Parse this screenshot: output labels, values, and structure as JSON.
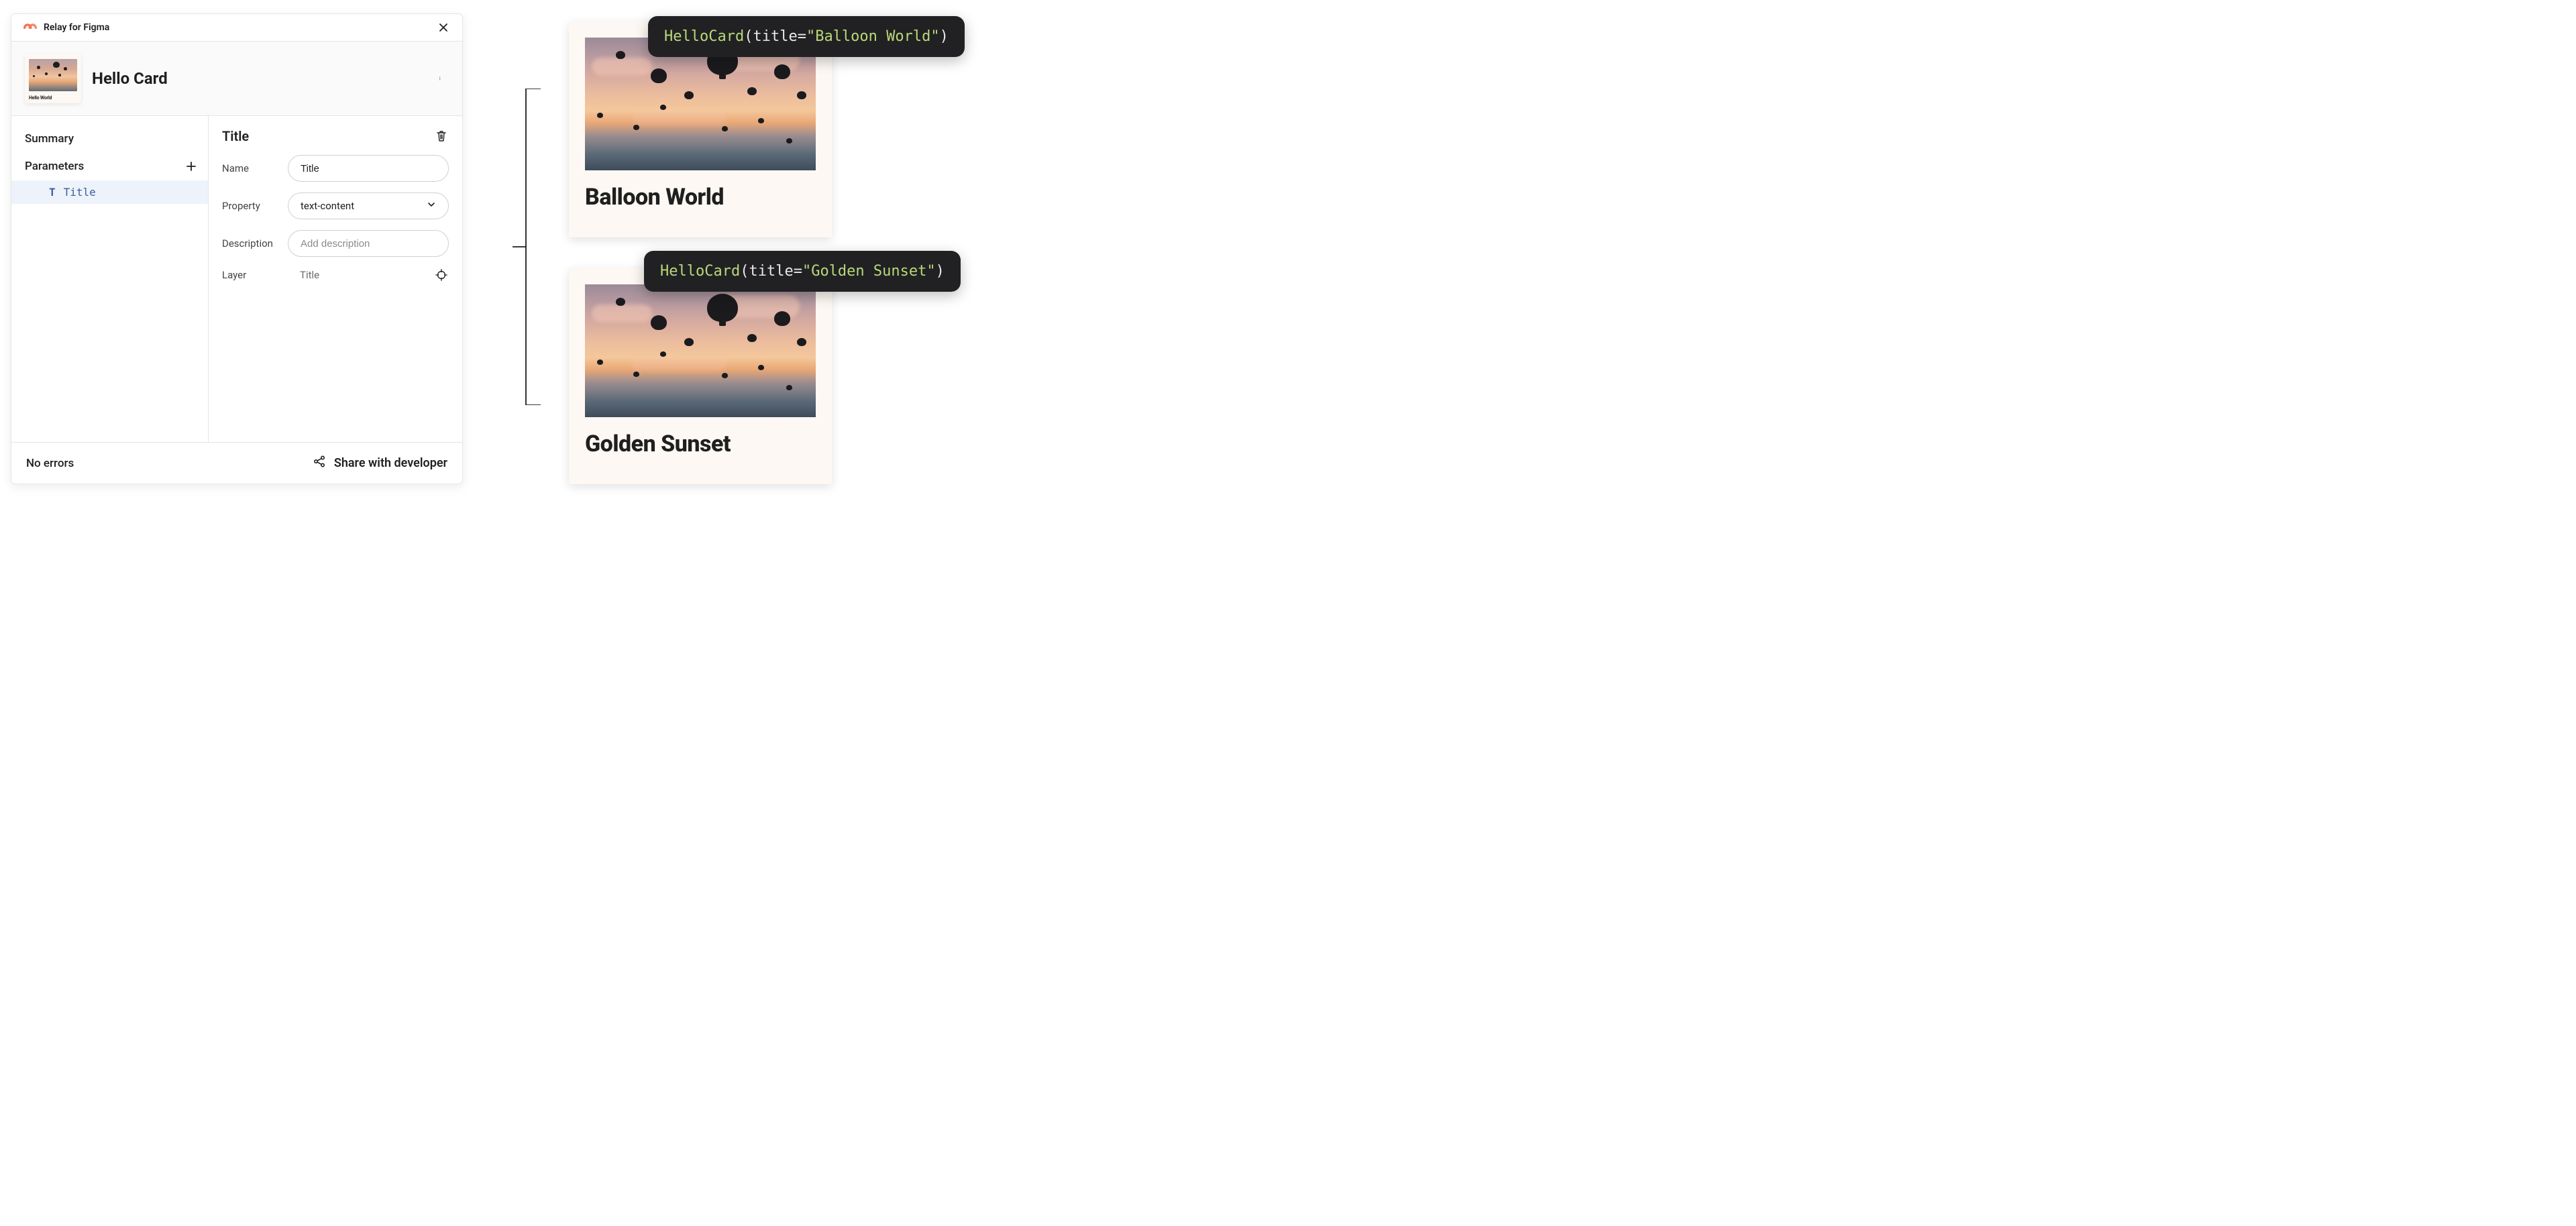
{
  "plugin": {
    "title": "Relay for Figma",
    "component_name": "Hello Card",
    "thumb_caption": "Hello World"
  },
  "sidebar": {
    "summary_label": "Summary",
    "parameters_label": "Parameters",
    "items": [
      {
        "label": "Title"
      }
    ]
  },
  "detail": {
    "heading": "Title",
    "fields": {
      "name": {
        "label": "Name",
        "value": "Title"
      },
      "property": {
        "label": "Property",
        "value": "text-content"
      },
      "description": {
        "label": "Description",
        "placeholder": "Add description"
      },
      "layer": {
        "label": "Layer",
        "value": "Title"
      }
    }
  },
  "footer": {
    "status": "No errors",
    "share_label": "Share with developer"
  },
  "cards": [
    {
      "title": "Balloon World"
    },
    {
      "title": "Golden Sunset"
    }
  ],
  "code": [
    {
      "fn": "HelloCard",
      "param": "title",
      "value": "\"Balloon World\""
    },
    {
      "fn": "HelloCard",
      "param": "title",
      "value": "\"Golden Sunset\""
    }
  ]
}
